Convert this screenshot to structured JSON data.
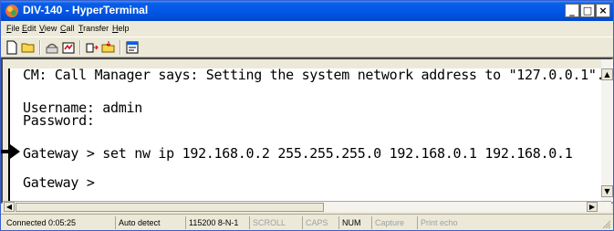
{
  "window": {
    "title": "DIV-140 - HyperTerminal",
    "controls": {
      "minimize": "_",
      "maximize": "□",
      "close": "×"
    }
  },
  "menu": [
    "File",
    "Edit",
    "View",
    "Call",
    "Transfer",
    "Help"
  ],
  "toolbar": {
    "icons": [
      "new-document-icon",
      "open-folder-icon",
      "call-icon",
      "disconnect-icon",
      "send-file-icon",
      "receive-file-icon",
      "properties-icon"
    ]
  },
  "terminal": {
    "lines": [
      "CM: Call Manager says: Setting the system network address to \"127.0.0.1\".",
      "",
      "Username: admin",
      "Password:",
      "",
      "Gateway > set nw ip 192.168.0.2 255.255.255.0 192.168.0.1 192.168.0.1",
      "",
      "Gateway >"
    ]
  },
  "statusbar": {
    "connected": "Connected 0:05:25",
    "detect": "Auto detect",
    "settings": "115200 8-N-1",
    "scroll": "SCROLL",
    "caps": "CAPS",
    "num": "NUM",
    "capture": "Capture",
    "print_echo": "Print echo"
  },
  "colors": {
    "title_bar": "#0055e5",
    "window_bg": "#ece9d8",
    "terminal_bg": "#ffffff"
  }
}
